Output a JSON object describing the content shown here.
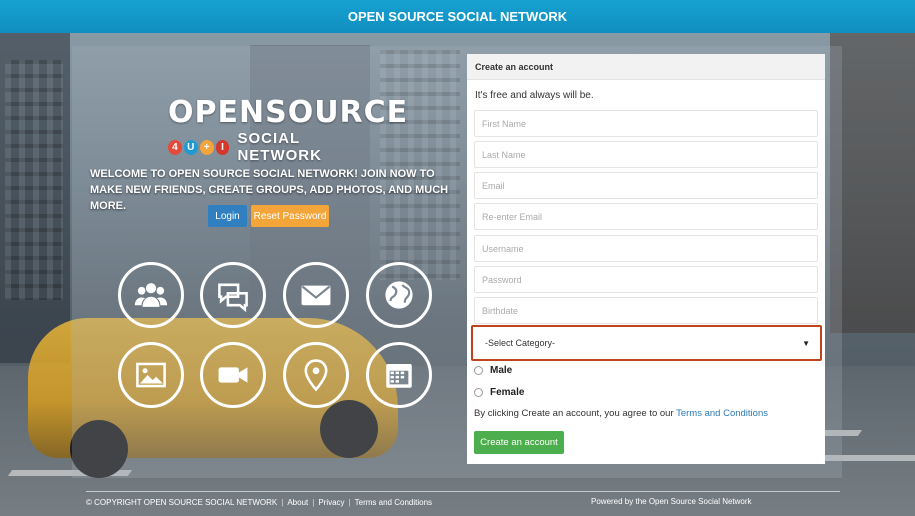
{
  "header": {
    "title": "OPEN SOURCE SOCIAL NETWORK"
  },
  "hero": {
    "logo_top": "OPENSOURCE",
    "logo_badges": [
      {
        "char": "4",
        "color": "#e24b3b"
      },
      {
        "char": "U",
        "color": "#1f9bd1"
      },
      {
        "char": "+",
        "color": "#f3a53a"
      },
      {
        "char": "I",
        "color": "#d4372c"
      }
    ],
    "logo_bottom": "SOCIAL NETWORK",
    "welcome_text": "WELCOME TO OPEN SOURCE SOCIAL NETWORK! JOIN NOW TO MAKE NEW FRIENDS, CREATE GROUPS, ADD PHOTOS, AND MUCH MORE.",
    "login_label": "Login",
    "reset_label": "Reset Password",
    "features": [
      {
        "icon": "users-icon"
      },
      {
        "icon": "chat-icon"
      },
      {
        "icon": "mail-icon"
      },
      {
        "icon": "globe-icon"
      },
      {
        "icon": "image-icon"
      },
      {
        "icon": "video-icon"
      },
      {
        "icon": "location-pin-icon"
      },
      {
        "icon": "calendar-icon"
      }
    ]
  },
  "form": {
    "heading": "Create an account",
    "tagline": "It's free and always will be.",
    "fields": {
      "first_name": "First Name",
      "last_name": "Last Name",
      "email": "Email",
      "reenter_email": "Re-enter Email",
      "username": "Username",
      "password": "Password",
      "birthdate": "Birthdate"
    },
    "category_selected": "-Select Category-",
    "gender_male": "Male",
    "gender_female": "Female",
    "terms_prefix": "By clicking Create an account, you agree to our ",
    "terms_link": "Terms and Conditions",
    "submit_label": "Create an account"
  },
  "footer": {
    "copyright": "© COPYRIGHT OPEN SOURCE SOCIAL NETWORK",
    "links": [
      "About",
      "Privacy",
      "Terms and Conditions"
    ],
    "separator": "|",
    "powered": "Powered by the Open Source Social Network"
  },
  "colors": {
    "header_bg": "#0f8fbf",
    "login_button": "#2f7fc1",
    "reset_button": "#f3a53a",
    "submit_button": "#4cae4c",
    "select_highlight": "#c0431c",
    "terms_link": "#2a7ab8"
  }
}
